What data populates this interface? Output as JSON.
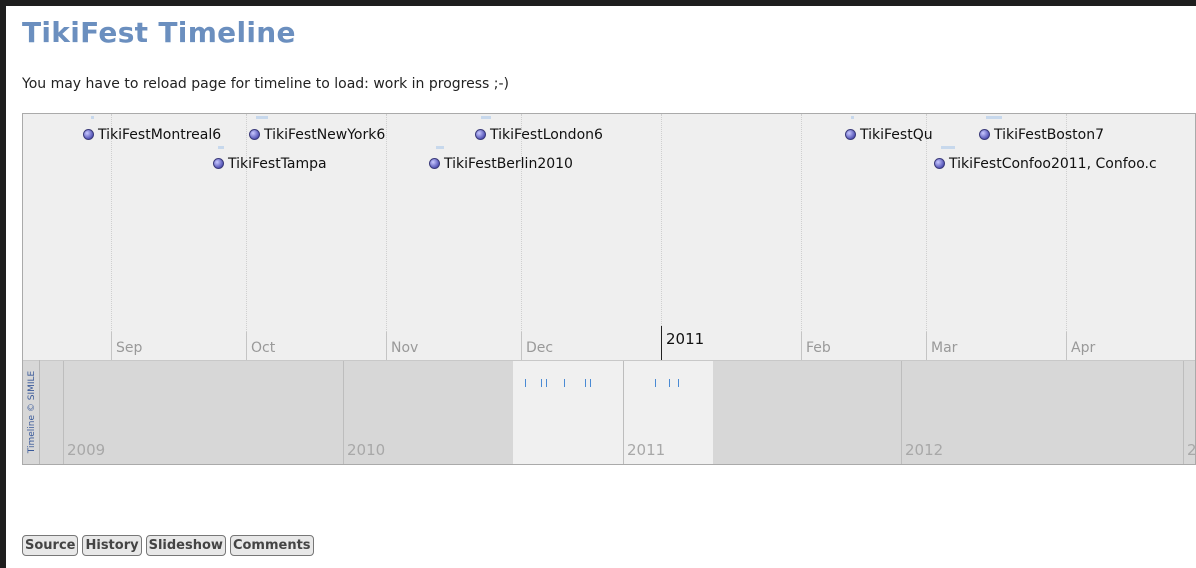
{
  "page": {
    "title": "TikiFest Timeline",
    "note": "You may have to reload page for timeline to load: work in progress ;-)"
  },
  "timeline": {
    "credit": "Timeline © SIMILE",
    "months": [
      "Sep",
      "Oct",
      "Nov",
      "Dec",
      "Feb",
      "Mar",
      "Apr"
    ],
    "year_marker": "2011",
    "events": [
      "TikiFestMontreal6",
      "TikiFestNewYork6",
      "TikiFestLondon6",
      "TikiFestTampa",
      "TikiFestBerlin2010",
      "TikiFestQu",
      "TikiFestBoston7",
      "TikiFestConfoo2011, Confoo.c"
    ],
    "overview_years": [
      "2009",
      "2010",
      "2011",
      "2012",
      "2"
    ]
  },
  "actions": {
    "source": "Source",
    "history": "History",
    "slideshow": "Slideshow",
    "comments": "Comments"
  },
  "colors": {
    "title": "#6b8fbf",
    "band_top": "#efefef",
    "band_bottom": "#d7d7d7",
    "event_dot": "#5656b8",
    "overview_tick": "#4a8ad4"
  }
}
